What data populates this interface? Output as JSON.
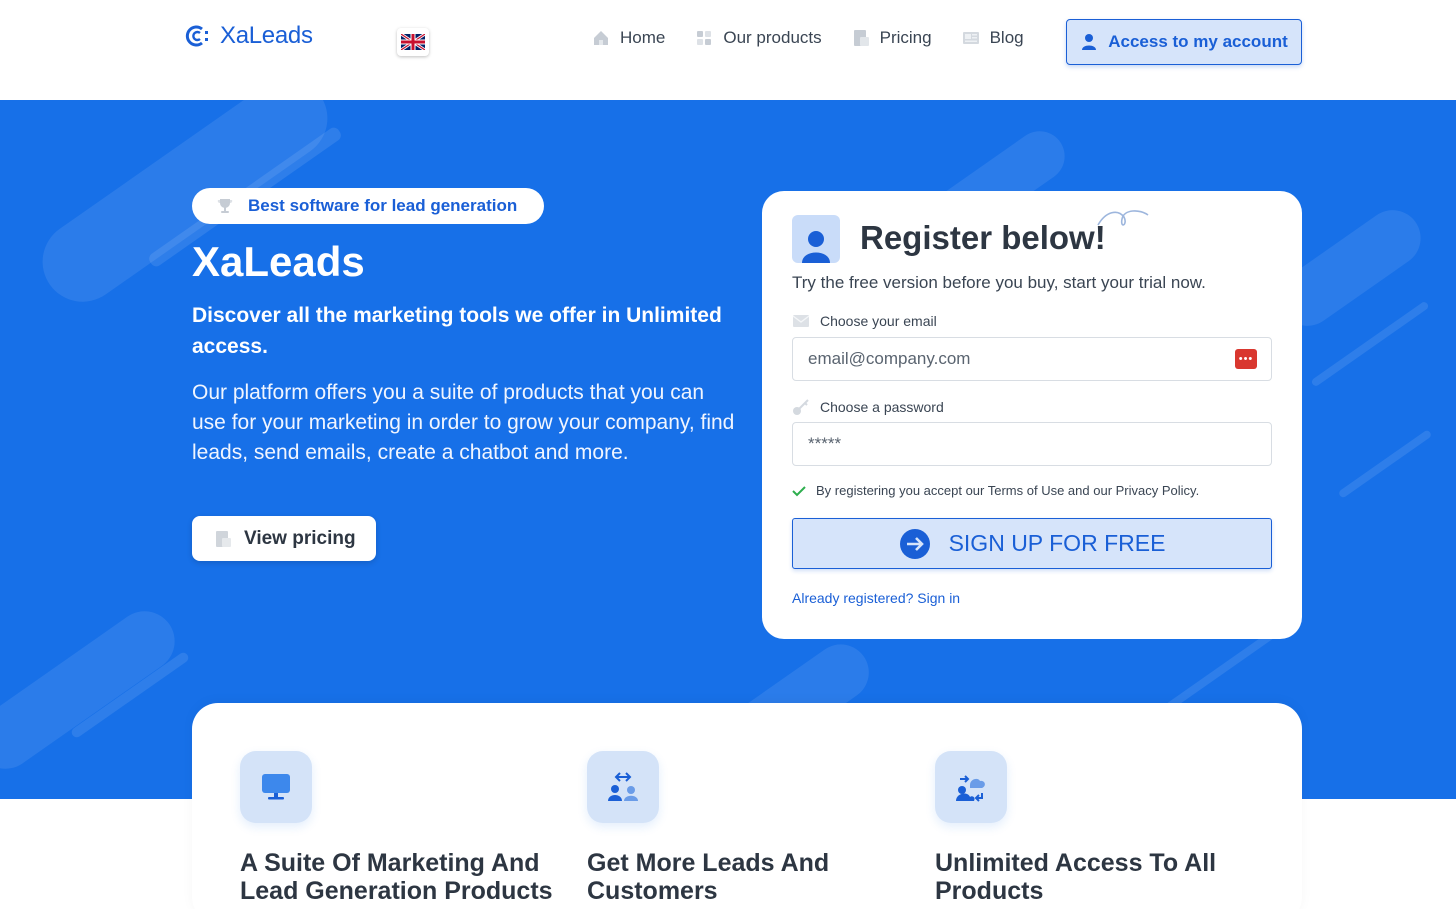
{
  "nav": {
    "logo_text": "XaLeads",
    "flag": "uk-flag-icon",
    "links": [
      {
        "label": "Home",
        "icon": "home-icon"
      },
      {
        "label": "Our products",
        "icon": "products-icon"
      },
      {
        "label": "Pricing",
        "icon": "pricing-icon"
      },
      {
        "label": "Blog",
        "icon": "blog-icon"
      }
    ],
    "account_label": "Access to my account"
  },
  "hero": {
    "badge": "Best software for lead generation",
    "title": "XaLeads",
    "subtitle": "Discover all the marketing tools we offer in Unlimited access.",
    "description": "Our platform offers you a suite of products that you can use for your marketing in order to grow your company, find leads, send emails, create a chatbot and more.",
    "pricing_button": "View pricing"
  },
  "form": {
    "title": "Register below!",
    "subtitle": "Try the free version before you buy, start your trial now.",
    "email_label": "Choose your email",
    "email_placeholder": "email@company.com",
    "password_label": "Choose a password",
    "password_placeholder": "*****",
    "terms": "By registering you accept our Terms of Use and our Privacy Policy.",
    "signup_button": "SIGN UP FOR FREE",
    "signin_link": "Already registered? Sign in"
  },
  "features": [
    {
      "title": "A Suite Of Marketing And Lead Generation Products",
      "icon": "monitor-icon"
    },
    {
      "title": "Get More Leads And Customers",
      "icon": "users-exchange-icon"
    },
    {
      "title": "Unlimited Access To All Products",
      "icon": "cloud-sync-icon"
    }
  ],
  "colors": {
    "brand": "#1a5fd6",
    "hero_bg": "#1770e8",
    "button_bg": "#d6e4fa",
    "error_red": "#d9372f"
  }
}
